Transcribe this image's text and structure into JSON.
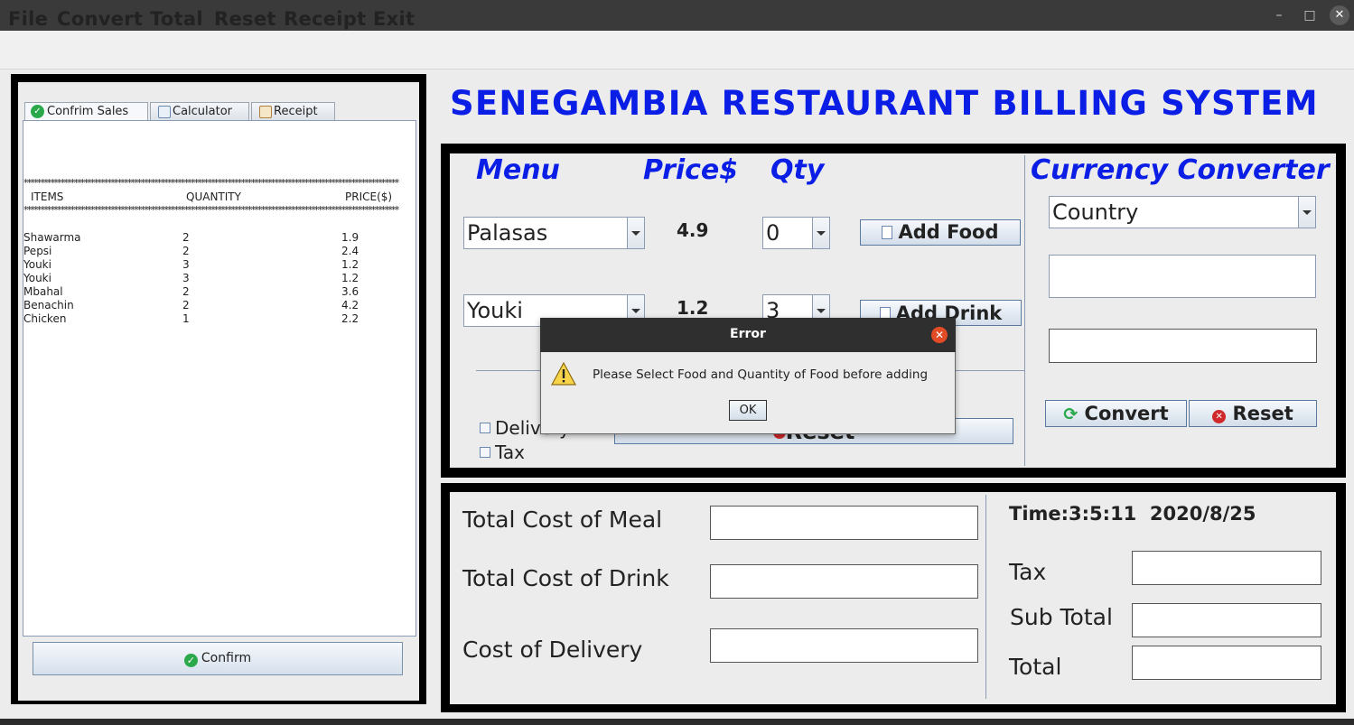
{
  "window": {
    "minimize_icon": "–",
    "maximize_icon": "□",
    "close_icon": "✕"
  },
  "menubar": {
    "items": [
      "File",
      "Convert",
      "Total",
      "Reset",
      "Receipt",
      "Exit"
    ]
  },
  "tabs": [
    {
      "label": "Confrim Sales",
      "icon": "check-circle-icon",
      "color": "#2aa84a"
    },
    {
      "label": "Calculator",
      "icon": "calculator-icon"
    },
    {
      "label": "Receipt",
      "icon": "receipt-icon"
    }
  ],
  "receipt": {
    "stars": "****************************************************************************************************************",
    "headers": {
      "items": "ITEMS",
      "quantity": "QUANTITY",
      "price": "PRICE($)"
    },
    "rows": [
      {
        "item": "Shawarma",
        "qty": "2",
        "price": "1.9"
      },
      {
        "item": "Pepsi",
        "qty": "2",
        "price": "2.4"
      },
      {
        "item": "Youki",
        "qty": "3",
        "price": "1.2"
      },
      {
        "item": "Youki",
        "qty": "3",
        "price": "1.2"
      },
      {
        "item": "Mbahal",
        "qty": "2",
        "price": "3.6"
      },
      {
        "item": "Benachin",
        "qty": "2",
        "price": "4.2"
      },
      {
        "item": "Chicken",
        "qty": "1",
        "price": "2.2"
      }
    ],
    "confirm_label": "Confirm"
  },
  "heading": "SENEGAMBIA RESTAURANT BILLING SYSTEM",
  "order": {
    "menu_header": "Menu",
    "price_header": "Price$",
    "qty_header": "Qty",
    "food": {
      "selected": "Palasas",
      "price": "4.9",
      "qty": "0",
      "button": "Add Food"
    },
    "drink": {
      "selected": "Youki",
      "price": "1.2",
      "qty": "3",
      "button": "Add Drink"
    },
    "delivery_label": "Delivery",
    "tax_label": "Tax",
    "reset_label": "Reset"
  },
  "converter": {
    "title": "Currency Converter",
    "country_selected": "Country",
    "convert_label": "Convert",
    "reset_label": "Reset"
  },
  "totals": {
    "meal_label": "Total Cost of Meal",
    "drink_label": "Total Cost of Drink",
    "delivery_label": "Cost of Delivery",
    "time_text": "Time:3:5:11  2020/8/25",
    "tax_label": "Tax",
    "subtotal_label": "Sub Total",
    "total_label": "Total"
  },
  "dialog": {
    "title": "Error",
    "message": "Please Select Food and Quantity of Food before adding",
    "ok_label": "OK",
    "icon": "warning-icon"
  },
  "colors": {
    "accent": "#0a1ee6",
    "error_close": "#e24b26"
  }
}
